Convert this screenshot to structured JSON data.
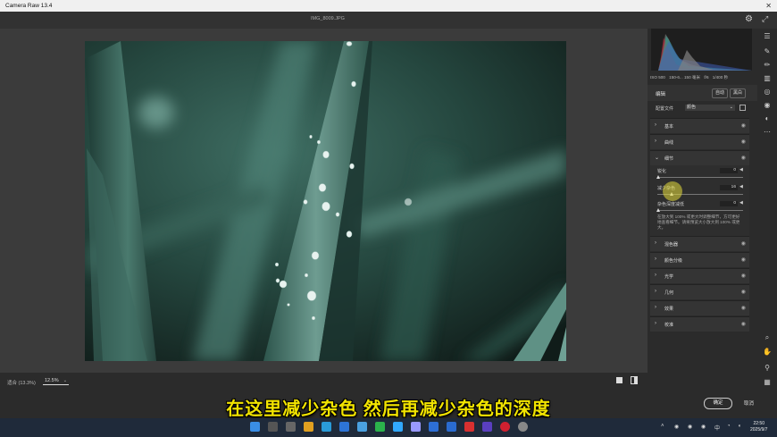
{
  "app": {
    "title": "Camera Raw 13.4",
    "close": "✕",
    "filename": "IMG_8009.JPG"
  },
  "bottom": {
    "zoom_fit": "适合 (13.3%)",
    "zoom_level": "12.5%"
  },
  "camera_info": {
    "iso": "ISO 500",
    "lens": "150-6... 150 毫米",
    "aperture": "f/6",
    "shutter": "1/400 秒"
  },
  "panel": {
    "edit_title": "编辑",
    "auto_label": "自动",
    "bw_label": "黑白",
    "profile_label": "配置文件",
    "profile_value": "颜色",
    "sections_top": [
      {
        "label": "基本",
        "arrow": "›"
      },
      {
        "label": "曲线",
        "arrow": "›"
      }
    ],
    "detail": {
      "label": "细节",
      "arrow": "⌄",
      "sharpen_label": "锐化",
      "sharpen_value": "0",
      "noise_label": "减少杂色",
      "noise_value": "16",
      "color_noise_label": "杂色深度减低",
      "color_noise_value": "0",
      "description": "在放大到 100% 或更大时调整细节，方可更好地查看细节。请将预览大小放大到 100% 或更大。"
    },
    "sections_bottom": [
      {
        "label": "混色器",
        "arrow": "›"
      },
      {
        "label": "颜色分级",
        "arrow": "›"
      },
      {
        "label": "光学",
        "arrow": "›"
      },
      {
        "label": "几何",
        "arrow": "›"
      },
      {
        "label": "效果",
        "arrow": "›"
      },
      {
        "label": "校准",
        "arrow": "›"
      }
    ]
  },
  "footer": {
    "ok": "确定",
    "cancel": "取消"
  },
  "subtitle": "在这里减少杂色 然后再减少杂色的深度",
  "taskbar": {
    "lang": "中",
    "time": "22:50",
    "date": "2025/9/7"
  },
  "colors": {
    "accent_subtitle": "#f2e400",
    "panel_bg": "#2b2b2b"
  }
}
